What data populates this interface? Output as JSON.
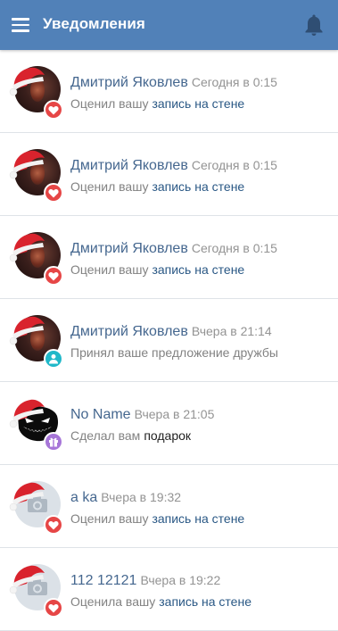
{
  "header": {
    "title": "Уведомления"
  },
  "notifications": [
    {
      "name": "Дмитрий Яковлев",
      "time": "Сегодня в 0:15",
      "action": "Оценил вашу",
      "object": "запись на стене",
      "avatar": "photo",
      "badge": "heart-icon",
      "badge_color": "#e64646"
    },
    {
      "name": "Дмитрий Яковлев",
      "time": "Сегодня в 0:15",
      "action": "Оценил вашу",
      "object": "запись на стене",
      "avatar": "photo",
      "badge": "heart-icon",
      "badge_color": "#e64646"
    },
    {
      "name": "Дмитрий Яковлев",
      "time": "Сегодня в 0:15",
      "action": "Оценил вашу",
      "object": "запись на стене",
      "avatar": "photo",
      "badge": "heart-icon",
      "badge_color": "#e64646"
    },
    {
      "name": "Дмитрий Яковлев",
      "time": "Вчера в 21:14",
      "action": "Принял ваше предложение дружбы",
      "object": "",
      "avatar": "photo",
      "badge": "user-icon",
      "badge_color": "#20b8c9"
    },
    {
      "name": "No Name",
      "time": "Вчера в 21:05",
      "action": "Сделал вам",
      "object": "подарок",
      "avatar": "dark-mask",
      "badge": "gift-icon",
      "badge_color": "#a776d8"
    },
    {
      "name": "a ka",
      "time": "Вчера в 19:32",
      "action": "Оценил вашу",
      "object": "запись на стене",
      "avatar": "camera",
      "badge": "heart-icon",
      "badge_color": "#e64646"
    },
    {
      "name": "112 12121",
      "time": "Вчера в 19:22",
      "action": "Оценила вашу",
      "object": "запись на стене",
      "avatar": "camera",
      "badge": "heart-icon",
      "badge_color": "#e64646"
    }
  ],
  "colors": {
    "header_bg": "#5181b8",
    "name": "#45678f",
    "link": "#2a5885"
  }
}
